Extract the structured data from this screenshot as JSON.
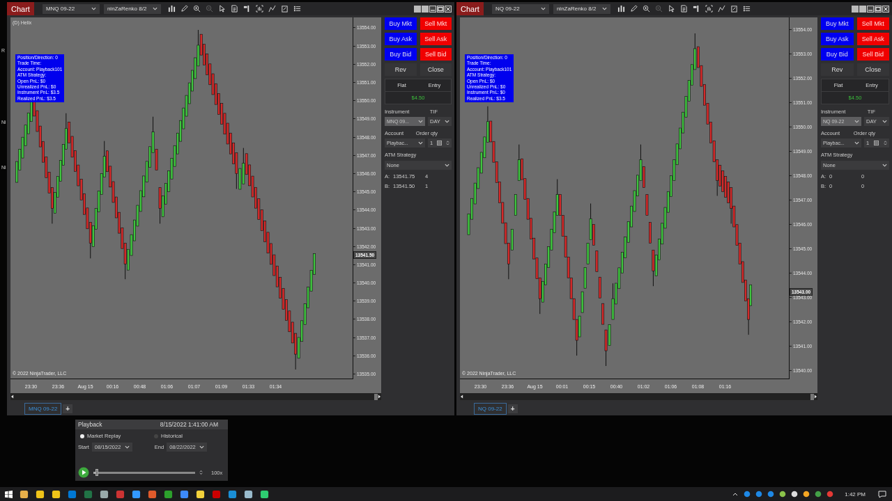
{
  "background_fragments": [
    "R",
    "Ni",
    "Ni"
  ],
  "charts": [
    {
      "title_button": "Chart",
      "instrument": "MNQ 09-22",
      "bar_type": "ninZaRenko 8/2",
      "indicator_label": "(D) Helix",
      "info_box": [
        "Position/Direction: 0",
        "Trade Time:",
        "Account: Playback101",
        "ATM Strategy:",
        "Open PnL: $0",
        "Unrealized PnL: $0",
        "Instrument PnL: $3.5",
        "Realized PnL: $3.5"
      ],
      "price_ticks": [
        "13554.00",
        "13553.00",
        "13552.00",
        "13551.00",
        "13550.00",
        "13549.00",
        "13548.00",
        "13547.00",
        "13546.00",
        "13545.00",
        "13544.00",
        "13543.00",
        "13542.00",
        "13541.00",
        "13540.00",
        "13539.00",
        "13538.00",
        "13537.00",
        "13536.00",
        "13535.00"
      ],
      "current_price": "13541.50",
      "copyright": "© 2022 NinjaTrader, LLC",
      "time_ticks": [
        "23:30",
        "23:36",
        "Aug 15",
        "00:16",
        "00:48",
        "01:06",
        "01:07",
        "01:09",
        "01:33",
        "01:34"
      ],
      "tabs": [
        {
          "label": "MNQ 09-22",
          "selected": true
        }
      ],
      "add_tab": "+",
      "order_panel": {
        "buttons": [
          {
            "label": "Buy Mkt",
            "kind": "buy"
          },
          {
            "label": "Sell Mkt",
            "kind": "sell"
          },
          {
            "label": "Buy Ask",
            "kind": "buy"
          },
          {
            "label": "Sell Ask",
            "kind": "sell"
          },
          {
            "label": "Buy Bid",
            "kind": "buy"
          },
          {
            "label": "Sell Bid",
            "kind": "sell"
          },
          {
            "label": "Rev",
            "kind": "plain"
          },
          {
            "label": "Close",
            "kind": "plain"
          }
        ],
        "position": "Flat",
        "entry": "Entry",
        "pnl": "$4.50",
        "instrument_label": "Instrument",
        "instrument": "MNQ 09...",
        "instrument_disabled": true,
        "tif_label": "TIF",
        "tif": "DAY",
        "account_label": "Account",
        "account": "Playbac...",
        "qty_label": "Order qty",
        "qty": "1",
        "atm_label": "ATM Strategy",
        "atm": "None",
        "quotes": [
          {
            "side": "A:",
            "price": "13541.75",
            "size": "4"
          },
          {
            "side": "B:",
            "price": "13541.50",
            "size": "1"
          }
        ]
      }
    },
    {
      "title_button": "Chart",
      "instrument": "NQ 09-22",
      "bar_type": "ninZaRenko 8/2",
      "info_box": [
        "Position/Direction: 0",
        "Trade Time:",
        "Account: Playback101",
        "ATM Strategy:",
        "Open PnL: $0",
        "Unrealized PnL: $0",
        "Instrument PnL: $0",
        "Realized PnL: $3.5"
      ],
      "price_ticks": [
        "13554.00",
        "13553.00",
        "13552.00",
        "13551.00",
        "13550.00",
        "13549.00",
        "13548.00",
        "13547.00",
        "13546.00",
        "13545.00",
        "13544.00",
        "13543.00",
        "13542.00",
        "13541.00",
        "13540.00"
      ],
      "current_price": "13543.00",
      "copyright": "© 2022 NinjaTrader, LLC",
      "time_ticks": [
        "23:30",
        "23:36",
        "Aug 15",
        "00:01",
        "00:15",
        "00:40",
        "01:02",
        "01:06",
        "01:08",
        "01:16"
      ],
      "tabs": [
        {
          "label": "NQ 09-22",
          "selected": true
        }
      ],
      "add_tab": "+",
      "order_panel": {
        "buttons": [
          {
            "label": "Buy Mkt",
            "kind": "buy"
          },
          {
            "label": "Sell Mkt",
            "kind": "sell"
          },
          {
            "label": "Buy Ask",
            "kind": "buy"
          },
          {
            "label": "Sell Ask",
            "kind": "sell"
          },
          {
            "label": "Buy Bid",
            "kind": "buy"
          },
          {
            "label": "Sell Bid",
            "kind": "sell"
          },
          {
            "label": "Rev",
            "kind": "plain"
          },
          {
            "label": "Close",
            "kind": "plain"
          }
        ],
        "position": "Flat",
        "entry": "Entry",
        "pnl": "$4.50",
        "instrument_label": "Instrument",
        "instrument": "NQ 09-22",
        "instrument_disabled": true,
        "tif_label": "TIF",
        "tif": "DAY",
        "account_label": "Account",
        "account": "Playbac...",
        "qty_label": "Order qty",
        "qty": "1",
        "atm_label": "ATM Strategy",
        "atm": "None",
        "quotes": [
          {
            "side": "A:",
            "price": "0",
            "size": "0"
          },
          {
            "side": "B:",
            "price": "0",
            "size": "0"
          }
        ]
      }
    }
  ],
  "playback": {
    "title": "Playback",
    "time": "8/15/2022 1:41:00 AM",
    "modes": [
      {
        "label": "Market Replay",
        "selected": true
      },
      {
        "label": "Historical",
        "selected": false
      }
    ],
    "start_label": "Start",
    "start": "08/15/2022",
    "end_label": "End",
    "end": "08/22/2022",
    "speed": {
      "level": 0.02
    },
    "speed_label": "100x"
  },
  "taskbar": {
    "clock": "1:42 PM"
  }
}
